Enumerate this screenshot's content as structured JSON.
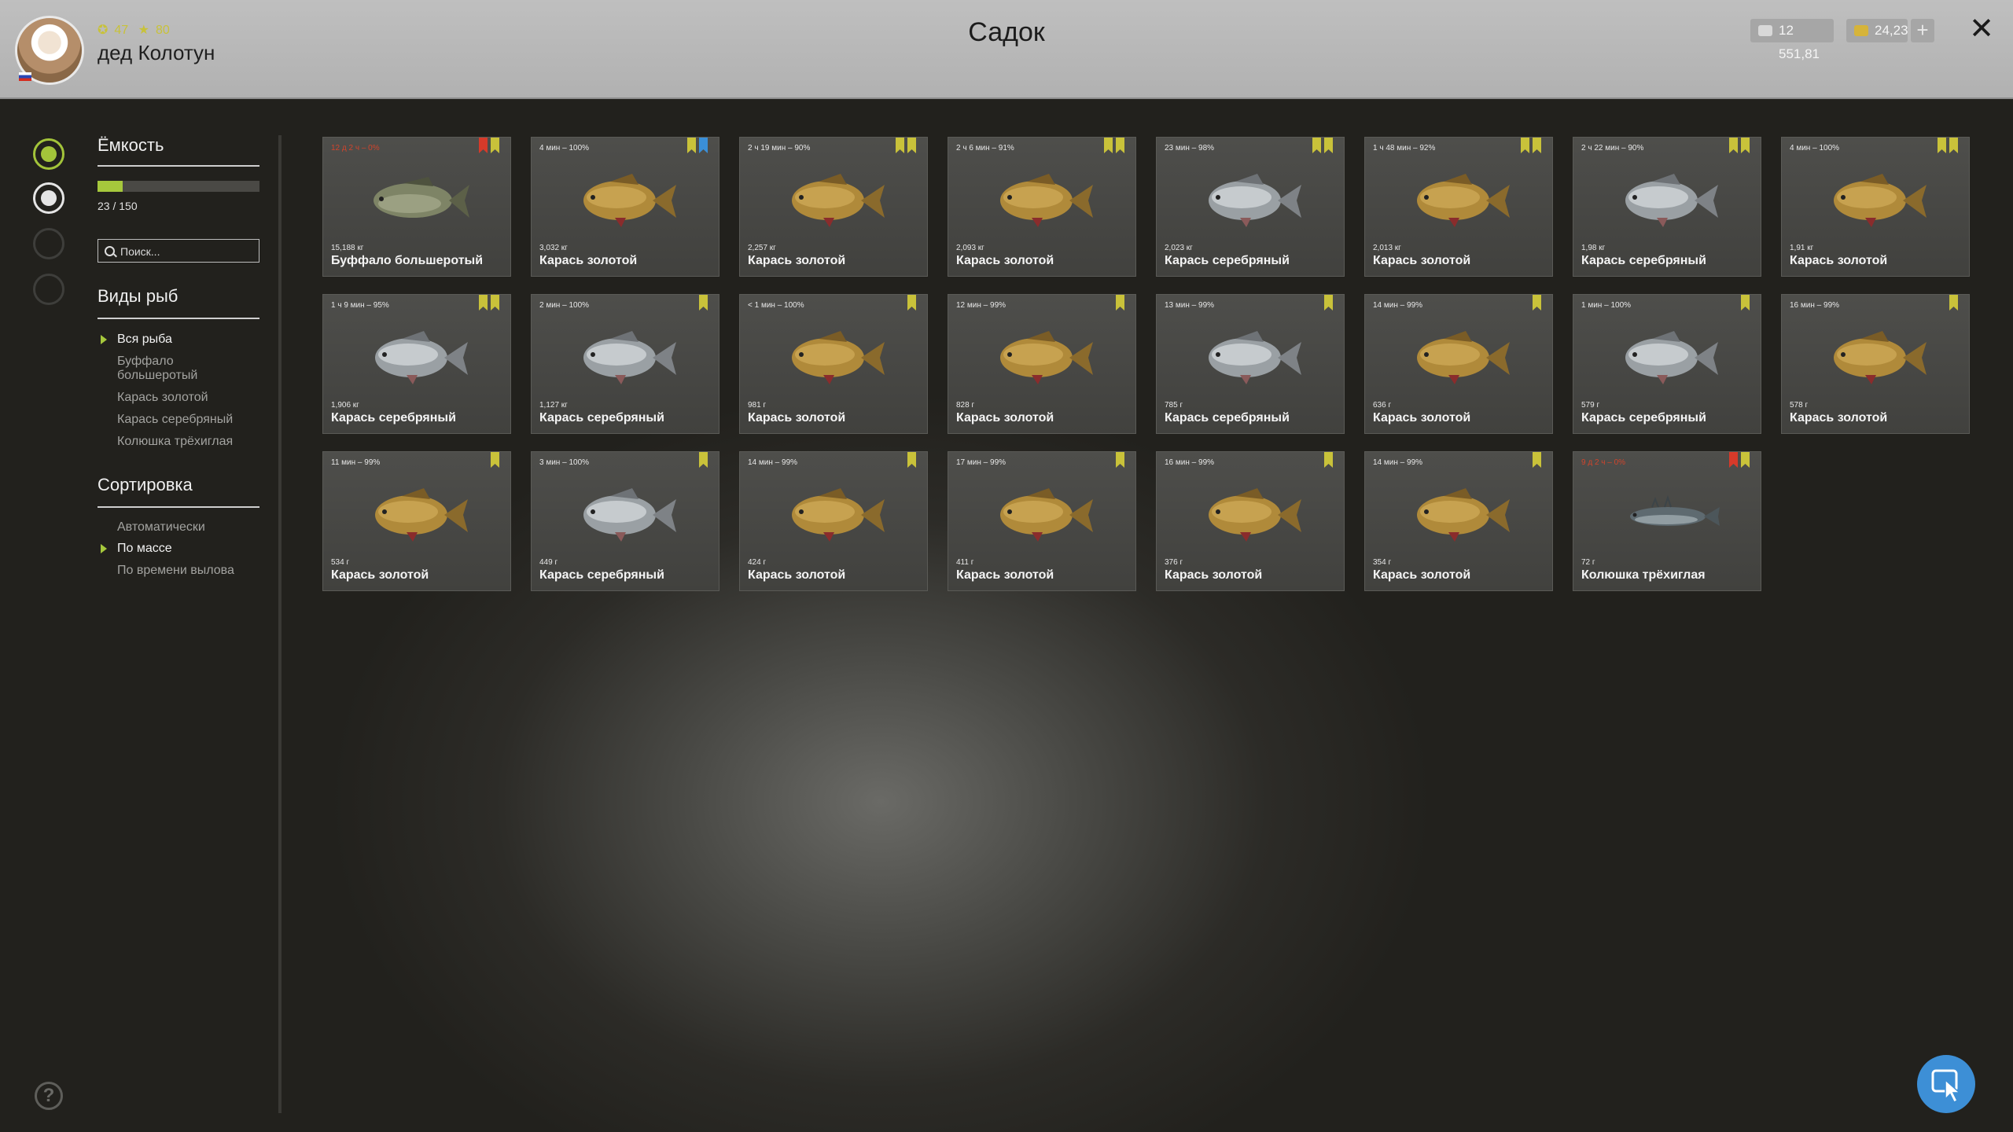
{
  "header": {
    "title": "Садок",
    "username": "дед Колотун",
    "level_stat": "47",
    "star_stat": "80",
    "silver": "12 551,81",
    "gold": "24,23",
    "add_label": "+",
    "close_label": "✕"
  },
  "capacity": {
    "title": "Ёмкость",
    "current": 23,
    "max": 150,
    "text": "23 / 150"
  },
  "search": {
    "placeholder": "Поиск..."
  },
  "species": {
    "title": "Виды рыб",
    "items": [
      {
        "label": "Вся рыба",
        "selected": true
      },
      {
        "label": "Буффало большеротый",
        "selected": false
      },
      {
        "label": "Карась золотой",
        "selected": false
      },
      {
        "label": "Карась серебряный",
        "selected": false
      },
      {
        "label": "Колюшка трёхиглая",
        "selected": false
      }
    ]
  },
  "sorting": {
    "title": "Сортировка",
    "items": [
      {
        "label": "Автоматически",
        "selected": false
      },
      {
        "label": "По массе",
        "selected": true
      },
      {
        "label": "По времени вылова",
        "selected": false
      }
    ]
  },
  "help_label": "?",
  "colors": {
    "accent": "#a6c83c",
    "mark_yellow": "#c9c23a",
    "mark_red": "#d63a2a",
    "mark_blue": "#3a8fd8",
    "cursor_button": "#3d8fd6"
  },
  "fish": [
    {
      "time": "12 д 2 ч – 0%",
      "time_red": true,
      "marks": [
        "r",
        "g"
      ],
      "weight": "15,188 кг",
      "name": "Буффало большеротый",
      "kind": "buffalo"
    },
    {
      "time": "4 мин – 100%",
      "time_red": false,
      "marks": [
        "g",
        "b"
      ],
      "weight": "3,032 кг",
      "name": "Карась золотой",
      "kind": "gold"
    },
    {
      "time": "2 ч 19 мин – 90%",
      "time_red": false,
      "marks": [
        "g",
        "g"
      ],
      "weight": "2,257 кг",
      "name": "Карась золотой",
      "kind": "gold"
    },
    {
      "time": "2 ч 6 мин – 91%",
      "time_red": false,
      "marks": [
        "g",
        "g"
      ],
      "weight": "2,093 кг",
      "name": "Карась золотой",
      "kind": "gold"
    },
    {
      "time": "23 мин – 98%",
      "time_red": false,
      "marks": [
        "g",
        "g"
      ],
      "weight": "2,023 кг",
      "name": "Карась серебряный",
      "kind": "silver"
    },
    {
      "time": "1 ч 48 мин – 92%",
      "time_red": false,
      "marks": [
        "g",
        "g"
      ],
      "weight": "2,013 кг",
      "name": "Карась золотой",
      "kind": "gold"
    },
    {
      "time": "2 ч 22 мин – 90%",
      "time_red": false,
      "marks": [
        "g",
        "g"
      ],
      "weight": "1,98 кг",
      "name": "Карась серебряный",
      "kind": "silver"
    },
    {
      "time": "4 мин – 100%",
      "time_red": false,
      "marks": [
        "g",
        "g"
      ],
      "weight": "1,91 кг",
      "name": "Карась золотой",
      "kind": "gold"
    },
    {
      "time": "1 ч 9 мин – 95%",
      "time_red": false,
      "marks": [
        "g",
        "g"
      ],
      "weight": "1,906 кг",
      "name": "Карась серебряный",
      "kind": "silver"
    },
    {
      "time": "2 мин – 100%",
      "time_red": false,
      "marks": [
        "g"
      ],
      "weight": "1,127 кг",
      "name": "Карась серебряный",
      "kind": "silver"
    },
    {
      "time": "< 1 мин – 100%",
      "time_red": false,
      "marks": [
        "g"
      ],
      "weight": "981 г",
      "name": "Карась золотой",
      "kind": "gold"
    },
    {
      "time": "12 мин – 99%",
      "time_red": false,
      "marks": [
        "g"
      ],
      "weight": "828 г",
      "name": "Карась золотой",
      "kind": "gold"
    },
    {
      "time": "13 мин – 99%",
      "time_red": false,
      "marks": [
        "g"
      ],
      "weight": "785 г",
      "name": "Карась серебряный",
      "kind": "silver"
    },
    {
      "time": "14 мин – 99%",
      "time_red": false,
      "marks": [
        "g"
      ],
      "weight": "636 г",
      "name": "Карась золотой",
      "kind": "gold"
    },
    {
      "time": "1 мин – 100%",
      "time_red": false,
      "marks": [
        "g"
      ],
      "weight": "579 г",
      "name": "Карась серебряный",
      "kind": "silver"
    },
    {
      "time": "16 мин – 99%",
      "time_red": false,
      "marks": [
        "g"
      ],
      "weight": "578 г",
      "name": "Карась золотой",
      "kind": "gold"
    },
    {
      "time": "11 мин – 99%",
      "time_red": false,
      "marks": [
        "g"
      ],
      "weight": "534 г",
      "name": "Карась золотой",
      "kind": "gold"
    },
    {
      "time": "3 мин – 100%",
      "time_red": false,
      "marks": [
        "g"
      ],
      "weight": "449 г",
      "name": "Карась серебряный",
      "kind": "silver"
    },
    {
      "time": "14 мин – 99%",
      "time_red": false,
      "marks": [
        "g"
      ],
      "weight": "424 г",
      "name": "Карась золотой",
      "kind": "gold"
    },
    {
      "time": "17 мин – 99%",
      "time_red": false,
      "marks": [
        "g"
      ],
      "weight": "411 г",
      "name": "Карась золотой",
      "kind": "gold"
    },
    {
      "time": "16 мин – 99%",
      "time_red": false,
      "marks": [
        "g"
      ],
      "weight": "376 г",
      "name": "Карась золотой",
      "kind": "gold"
    },
    {
      "time": "14 мин – 99%",
      "time_red": false,
      "marks": [
        "g"
      ],
      "weight": "354 г",
      "name": "Карась золотой",
      "kind": "gold"
    },
    {
      "time": "9 д 2 ч – 0%",
      "time_red": true,
      "marks": [
        "r",
        "g"
      ],
      "weight": "72 г",
      "name": "Колюшка трёхиглая",
      "kind": "stickleback"
    }
  ]
}
